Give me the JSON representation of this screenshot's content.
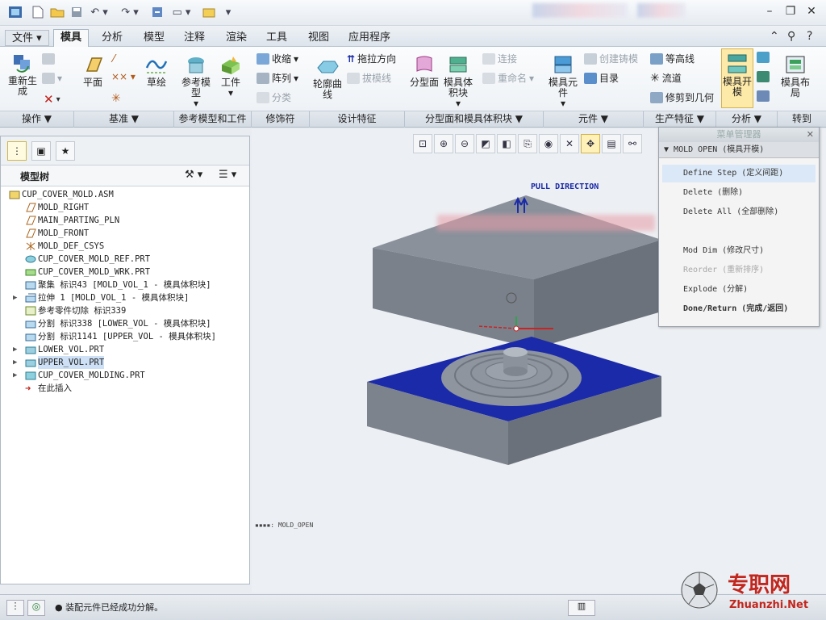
{
  "ribbon_tabs": [
    "文件",
    "模具",
    "分析",
    "模型",
    "注释",
    "渲染",
    "工具",
    "视图",
    "应用程序"
  ],
  "active_tab": "模具",
  "ribbon": {
    "regen": "重新生成",
    "plane": "平面",
    "sketch": "草绘",
    "ref_model": "参考模型",
    "workpiece": "工件",
    "shrink": "收缩",
    "pattern": "阵列",
    "classify": "分类",
    "contour_curve": "轮廓曲线",
    "drag_dir": "拖拉方向",
    "draft_line": "拔模线",
    "parting_surface": "分型面",
    "volume": "模具体积块",
    "connect": "连接",
    "rename": "重命名",
    "mold_component": "模具元件",
    "create_casting": "创建铸模",
    "catalog": "目录",
    "contour_line": "等高线",
    "runner": "流道",
    "trim_geometry": "修剪到几何",
    "mold_open": "模具开模",
    "mold_layout": "模具布局"
  },
  "ribbon_groups": [
    "操作 ▼",
    "基准 ▼",
    "参考模型和工件",
    "修饰符",
    "设计特征",
    "分型面和模具体积块 ▼",
    "元件 ▼",
    "生产特征 ▼",
    "分析 ▼",
    "转到"
  ],
  "model_tree": {
    "title": "模型树",
    "items": [
      "CUP_COVER_MOLD.ASM",
      "MOLD_RIGHT",
      "MAIN_PARTING_PLN",
      "MOLD_FRONT",
      "MOLD_DEF_CSYS",
      "CUP_COVER_MOLD_REF.PRT",
      "CUP_COVER_MOLD_WRK.PRT",
      "聚集 标识43 [MOLD_VOL_1 - 模具体积块]",
      "拉伸 1 [MOLD_VOL_1 - 模具体积块]",
      "参考零件切除 标识339",
      "分割 标识338 [LOWER_VOL - 模具体积块]",
      "分割 标识1141 [UPPER_VOL - 模具体积块]",
      "LOWER_VOL.PRT",
      "UPPER_VOL.PRT",
      "CUP_COVER_MOLDING.PRT",
      "在此插入"
    ]
  },
  "viewport": {
    "pull_direction": "PULL DIRECTION",
    "view_label": "MOLD_OPEN"
  },
  "menu_manager": {
    "title": "菜单管理器",
    "submenu": "MOLD OPEN (模具开模)",
    "items": [
      "Define Step (定义间距)",
      "Delete (删除)",
      "Delete All (全部删除)",
      "Mod Dim (修改尺寸)",
      "Reorder (重新排序)",
      "Explode (分解)",
      "Done/Return (完成/返回)"
    ]
  },
  "status_message": "装配元件已经成功分解。",
  "watermark": {
    "cn": "专职网",
    "url": "Zhuanzhi.Net"
  },
  "colors": {
    "accent_blue": "#1b2aa8",
    "mold_gray": "#7d8590",
    "watermark_red": "#c2261d"
  }
}
